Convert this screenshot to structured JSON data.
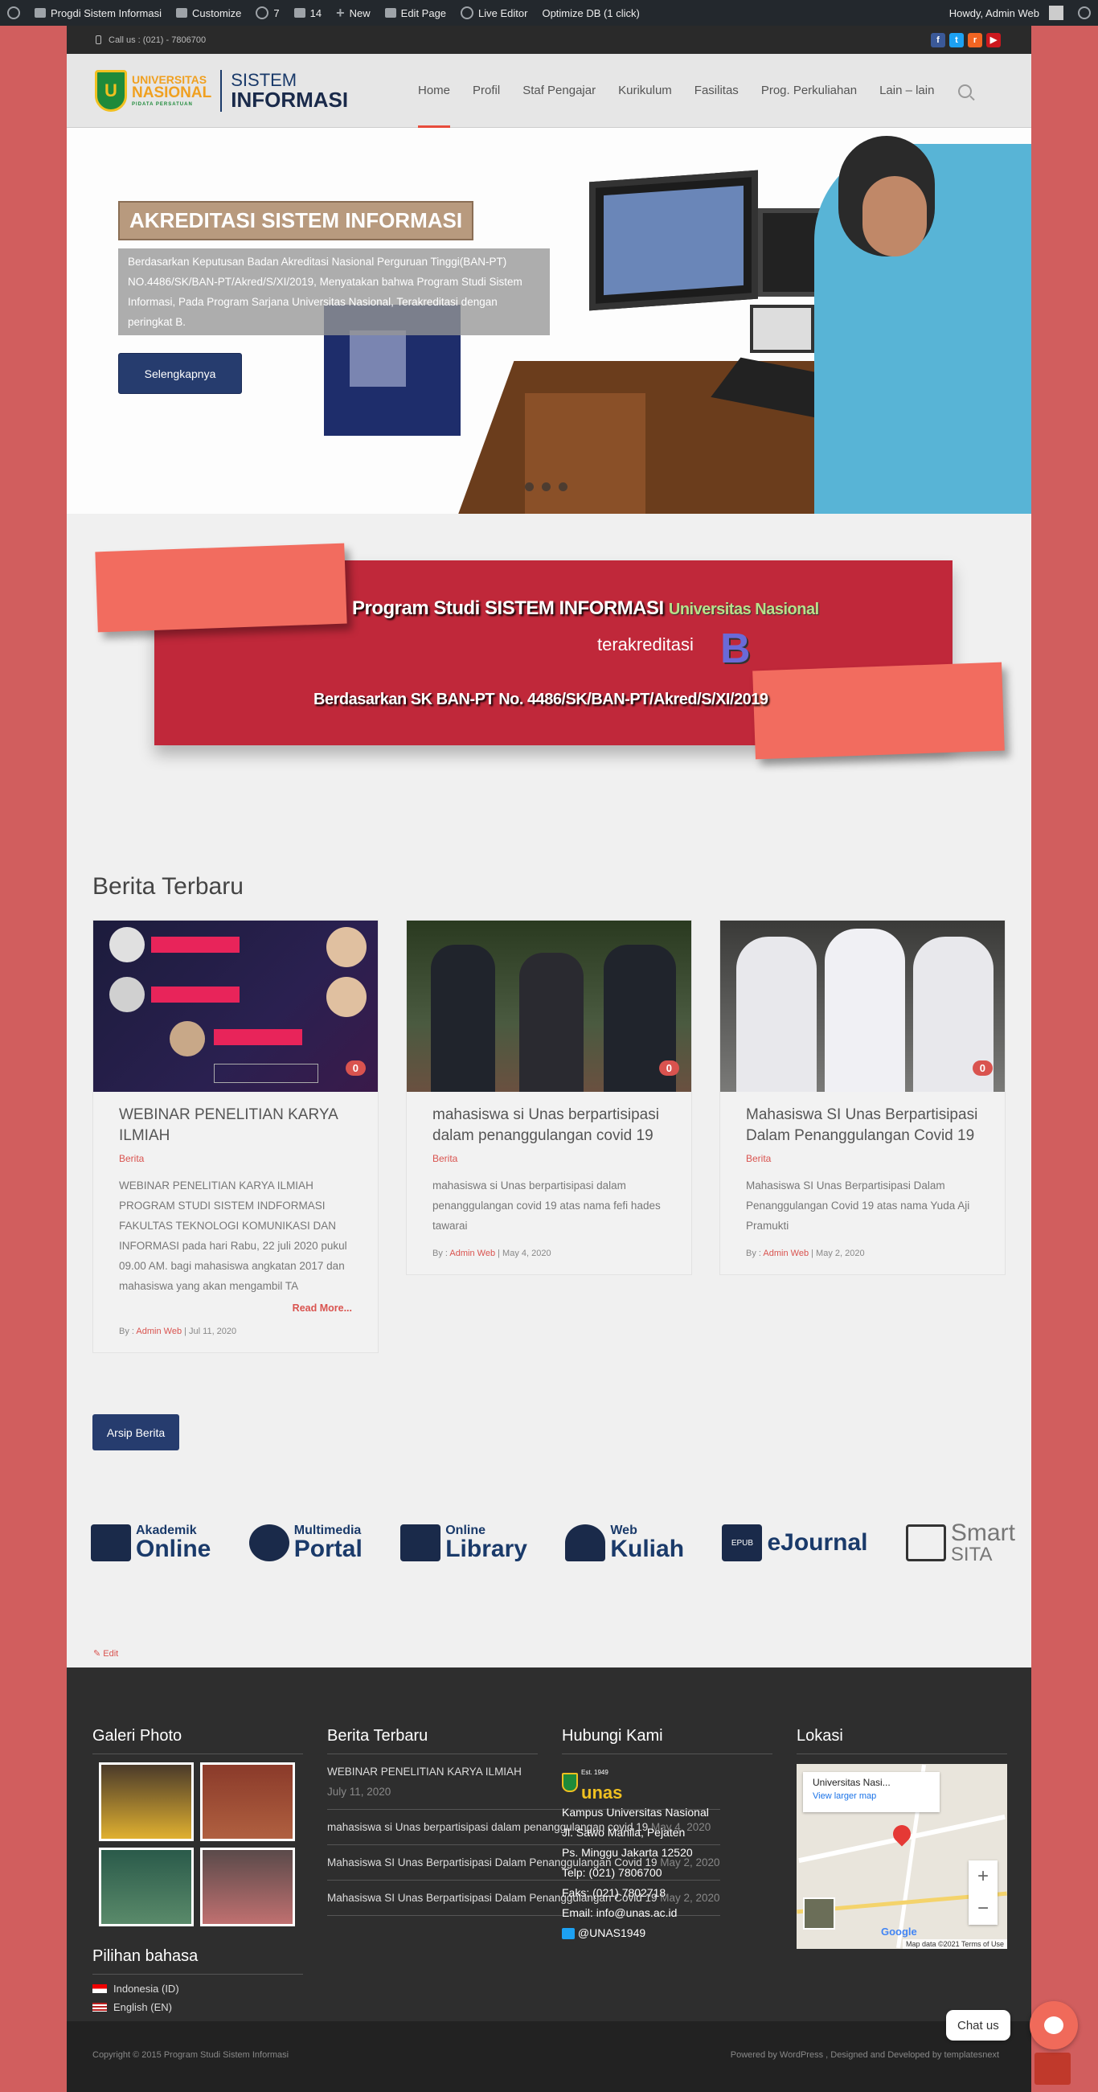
{
  "adminbar": {
    "site_name": "Progdi Sistem Informasi",
    "customize": "Customize",
    "updates": "7",
    "comments": "14",
    "new": "New",
    "edit_page": "Edit Page",
    "live_editor": "Live Editor",
    "optimize": "Optimize DB (1 click)",
    "howdy": "Howdy, Admin Web"
  },
  "topbar": {
    "phone": "Call us : (021) - 7806700"
  },
  "logo": {
    "univ_line1": "UNIVERSITAS",
    "univ_line2": "NASIONAL",
    "univ_line3": "PIDATA PERSATUAN",
    "si_line1": "SISTEM",
    "si_line2": "INFORMASI"
  },
  "nav": {
    "items": [
      "Home",
      "Profil",
      "Staf Pengajar",
      "Kurikulum",
      "Fasilitas",
      "Prog. Perkuliahan",
      "Lain – lain"
    ]
  },
  "hero": {
    "title": "AKREDITASI SISTEM INFORMASI",
    "desc": "Berdasarkan Keputusan Badan Akreditasi Nasional Perguruan Tinggi(BAN-PT) NO.4486/SK/BAN-PT/Akred/S/XI/2019, Menyatakan bahwa Program Studi Sistem Informasi, Pada Program Sarjana Universitas Nasional, Terakreditasi dengan peringkat B.",
    "button": "Selengkapnya"
  },
  "banner": {
    "line1a": "Program Studi SISTEM INFORMASI",
    "line1b": "Universitas Nasional",
    "line2": "terakreditasi",
    "grade": "B",
    "line3a": "Berdasarkan SK BAN-PT",
    "line3b": "No.  4486/SK/BAN-PT/Akred/S/XI/2019"
  },
  "news": {
    "heading": "Berita Terbaru",
    "cards": [
      {
        "title": "WEBINAR PENELITIAN KARYA ILMIAH",
        "cat": "Berita",
        "comments": "0",
        "excerpt": "WEBINAR PENELITIAN KARYA ILMIAH PROGRAM STUDI SISTEM INDFORMASI FAKULTAS TEKNOLOGI KOMUNIKASI DAN INFORMASI pada hari Rabu, 22 juli 2020 pukul 09.00 AM. bagi mahasiswa angkatan 2017 dan mahasiswa yang akan mengambil TA",
        "more": "Read More...",
        "by": "By : ",
        "author": "Admin Web",
        "date": " | Jul 11, 2020"
      },
      {
        "title": "mahasiswa si Unas berpartisipasi dalam penanggulangan covid 19",
        "cat": "Berita",
        "comments": "0",
        "excerpt": "mahasiswa si Unas berpartisipasi dalam penanggulangan covid 19 atas nama fefi hades tawarai",
        "by": "By : ",
        "author": "Admin Web",
        "date": " | May 4, 2020"
      },
      {
        "title": "Mahasiswa SI Unas Berpartisipasi Dalam Penanggulangan Covid 19",
        "cat": "Berita",
        "comments": "0",
        "excerpt": "Mahasiswa SI Unas Berpartisipasi Dalam Penanggulangan Covid 19 atas nama Yuda Aji Pramukti",
        "by": "By : ",
        "author": "Admin Web",
        "date": " | May 2, 2020"
      }
    ],
    "archive_button": "Arsip Berita"
  },
  "links": [
    {
      "small": "Akademik",
      "big": "Online"
    },
    {
      "small": "Multimedia",
      "big": "Portal"
    },
    {
      "small": "Online",
      "big": "Library"
    },
    {
      "small": "Web",
      "big": "Kuliah"
    },
    {
      "small": "EPUB",
      "big": "eJournal"
    },
    {
      "small": "Smart",
      "big": "SITA"
    }
  ],
  "edit_link": "Edit",
  "footer": {
    "galeri": "Galeri Photo",
    "bahasa": "Pilihan bahasa",
    "lang_id": "Indonesia  (ID)",
    "lang_en": "English  (EN)",
    "berita": "Berita Terbaru",
    "berita_items": [
      {
        "title": "WEBINAR PENELITIAN KARYA ILMIAH",
        "date": "July 11, 2020"
      },
      {
        "title": "mahasiswa si Unas berpartisipasi dalam penanggulangan covid 19",
        "date": "May 4, 2020"
      },
      {
        "title": "Mahasiswa SI Unas Berpartisipasi Dalam Penanggulangan Covid 19",
        "date": "May 2, 2020"
      },
      {
        "title": "Mahasiswa SI Unas Berpartisipasi Dalam Penanggulangan Covid 19",
        "date": "May 2, 2020"
      }
    ],
    "hubungi": "Hubungi Kami",
    "est": "Est. 1949",
    "unas": "unas",
    "addr1": "Kampus Universitas Nasional",
    "addr2": "Jl. Sawo Manila, Pejaten",
    "addr3": "Ps. Minggu Jakarta 12520",
    "telp": "Telp: (021) 7806700",
    "faks": "Faks: (021) 7802718",
    "email": "Email: info@unas.ac.id",
    "twitter": "@UNAS1949",
    "lokasi": "Lokasi",
    "map_place": "Universitas Nasi...",
    "map_link": "View larger map",
    "map_google": "Google",
    "map_data": "Map data ©2021    Terms of Use"
  },
  "copyright": "Copyright © 2015 Program Studi Sistem Informasi",
  "powered": "Powered by WordPress , Designed and Developed by templatesnext",
  "chat": "Chat us"
}
